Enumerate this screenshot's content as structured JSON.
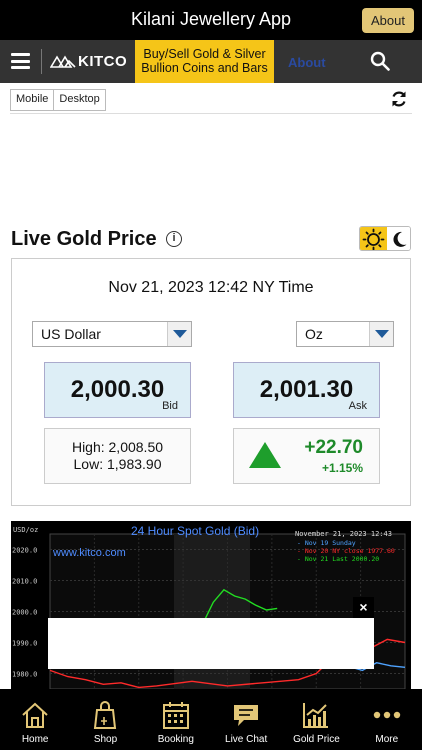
{
  "app": {
    "title": "Kilani Jewellery App",
    "about_button": "About"
  },
  "nav": {
    "logo": "KITCO",
    "promo_line1": "Buy/Sell Gold & Silver",
    "promo_line2": "Bullion Coins and Bars",
    "about_link": "About"
  },
  "view_toggle": {
    "mobile": "Mobile",
    "desktop": "Desktop"
  },
  "live_gold": {
    "heading": "Live Gold Price",
    "datetime": "Nov 21, 2023 12:42 NY Time",
    "currency": "US Dollar",
    "unit": "Oz",
    "bid": {
      "value": "2,000.30",
      "label": "Bid"
    },
    "ask": {
      "value": "2,001.30",
      "label": "Ask"
    },
    "high": "High: 2,008.50",
    "low": "Low: 1,983.90",
    "change": "+22.70",
    "change_pct": "+1.15%",
    "colors": {
      "accent": "#f5c518",
      "up": "#1e9e2c",
      "quote_bg": "#ddeef6"
    }
  },
  "chart_data": {
    "type": "line",
    "title": "24 Hour Spot Gold (Bid)",
    "watermark": "www.kitco.com",
    "ylabel": "USD/oz",
    "y_ticks": [
      "2020.0",
      "2010.0",
      "2000.0",
      "1990.0",
      "1980.0"
    ],
    "ylim": [
      1975,
      2025
    ],
    "header_date": "November 21, 2023 12:43",
    "legend": [
      {
        "label": "Nov 19 Sunday",
        "color": "#4fa3ff"
      },
      {
        "label": "Nov 20 NY close 1977.60",
        "color": "#ff2a2a"
      },
      {
        "label": "Nov 21 Last 2000.20",
        "color": "#22dd22"
      }
    ],
    "series": [
      {
        "name": "Nov 19 Sunday",
        "color": "#4fa3ff",
        "values": [
          [
            0.82,
            1984.5
          ],
          [
            0.85,
            1982.0
          ],
          [
            0.88,
            1981.0
          ],
          [
            0.92,
            1983.5
          ],
          [
            0.96,
            1982.5
          ],
          [
            1.0,
            1982.0
          ]
        ]
      },
      {
        "name": "Nov 20 NY close 1977.60",
        "color": "#ff2a2a",
        "values": [
          [
            0.0,
            1981.0
          ],
          [
            0.05,
            1979.0
          ],
          [
            0.1,
            1978.0
          ],
          [
            0.15,
            1976.5
          ],
          [
            0.2,
            1977.0
          ],
          [
            0.25,
            1975.5
          ],
          [
            0.3,
            1976.0
          ],
          [
            0.4,
            1977.5
          ],
          [
            0.5,
            1976.0
          ],
          [
            0.6,
            1977.0
          ],
          [
            0.7,
            1978.0
          ],
          [
            0.75,
            1980.0
          ],
          [
            0.8,
            1985.5
          ],
          [
            0.85,
            1989.0
          ],
          [
            0.9,
            1988.0
          ],
          [
            0.95,
            1991.0
          ],
          [
            1.0,
            1990.0
          ]
        ]
      },
      {
        "name": "Nov 21 Last 2000.20",
        "color": "#22dd22",
        "values": [
          [
            0.4,
            1991.0
          ],
          [
            0.43,
            1996.0
          ],
          [
            0.46,
            2003.0
          ],
          [
            0.49,
            2007.0
          ],
          [
            0.52,
            2005.0
          ],
          [
            0.55,
            2004.0
          ],
          [
            0.58,
            2002.0
          ],
          [
            0.61,
            2000.5
          ],
          [
            0.64,
            2001.0
          ]
        ]
      }
    ]
  },
  "ad": {
    "close": "×"
  },
  "tabs": [
    {
      "label": "Home",
      "icon": "home-icon"
    },
    {
      "label": "Shop",
      "icon": "shopping-bag-icon"
    },
    {
      "label": "Booking",
      "icon": "calendar-icon"
    },
    {
      "label": "Live Chat",
      "icon": "chat-icon"
    },
    {
      "label": "Gold Price",
      "icon": "chart-icon"
    },
    {
      "label": "More",
      "icon": "more-icon"
    }
  ]
}
